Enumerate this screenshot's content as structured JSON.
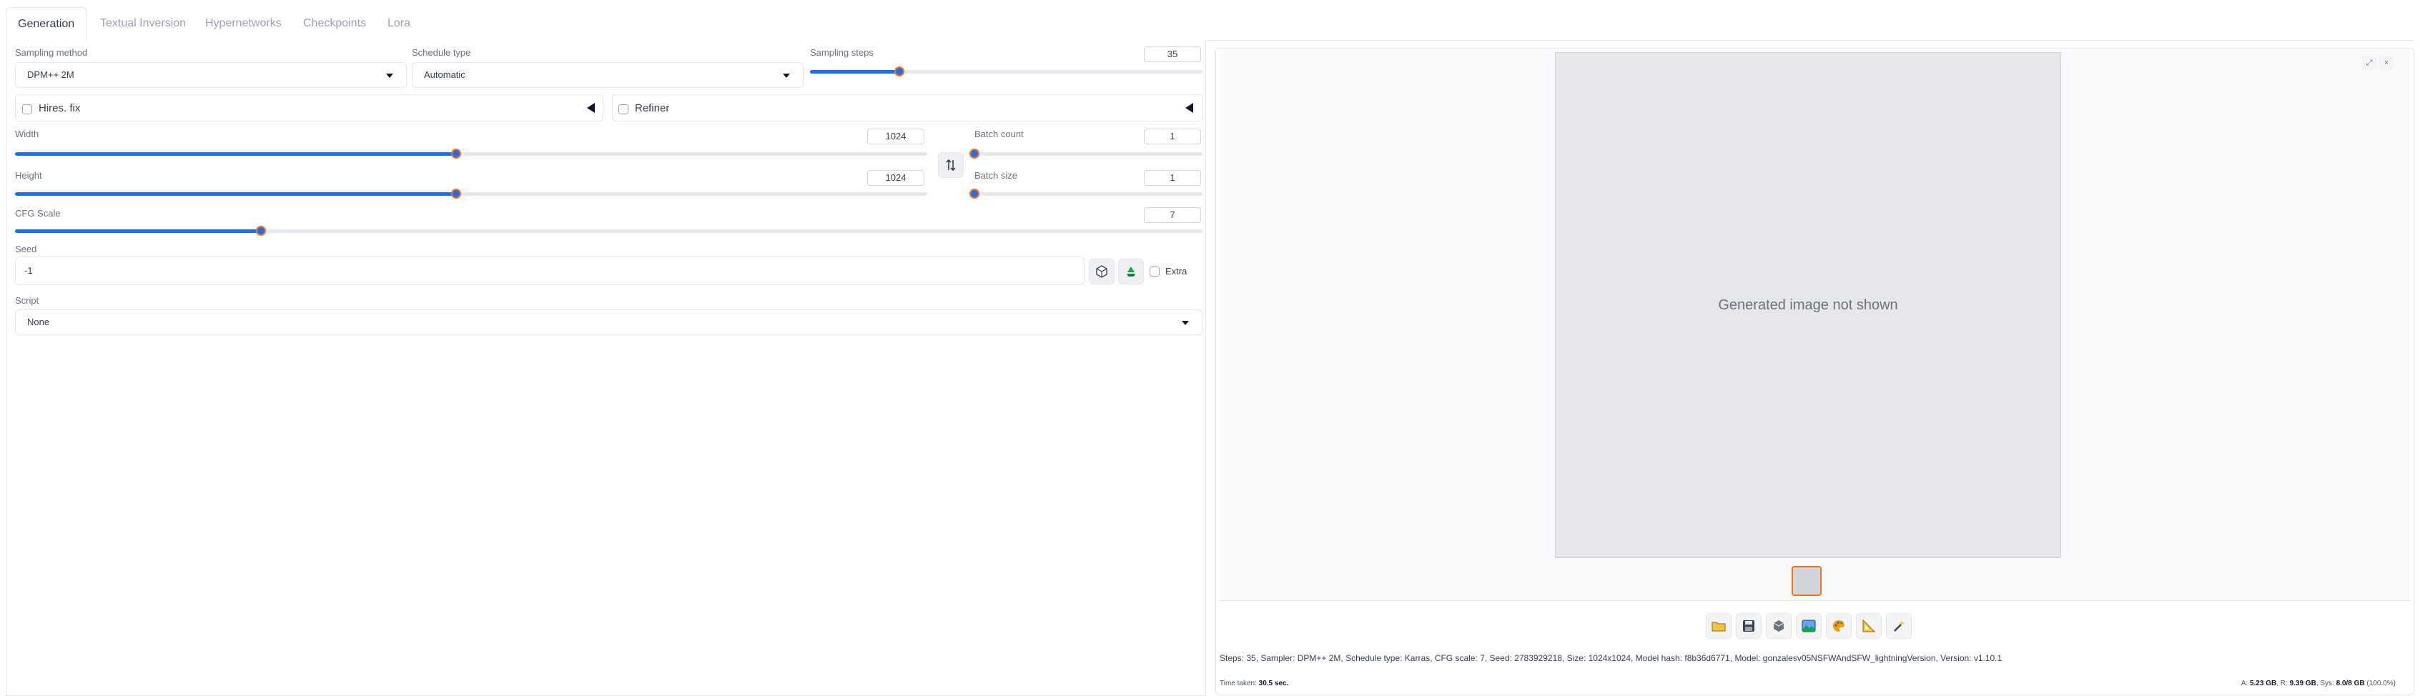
{
  "tabs": [
    "Generation",
    "Textual Inversion",
    "Hypernetworks",
    "Checkpoints",
    "Lora"
  ],
  "sampling_method": {
    "label": "Sampling method",
    "value": "DPM++ 2M"
  },
  "schedule_type": {
    "label": "Schedule type",
    "value": "Automatic"
  },
  "sampling_steps": {
    "label": "Sampling steps",
    "value": "35",
    "min": 1,
    "max": 150
  },
  "hires_fix": {
    "label": "Hires. fix",
    "checked": false
  },
  "refiner": {
    "label": "Refiner",
    "checked": false
  },
  "width": {
    "label": "Width",
    "value": "1024",
    "min": 64,
    "max": 2048
  },
  "height": {
    "label": "Height",
    "value": "1024",
    "min": 64,
    "max": 2048
  },
  "batch_count": {
    "label": "Batch count",
    "value": "1",
    "min": 1,
    "max": 100
  },
  "batch_size": {
    "label": "Batch size",
    "value": "1",
    "min": 1,
    "max": 8
  },
  "cfg_scale": {
    "label": "CFG Scale",
    "value": "7",
    "min": 1,
    "max": 30
  },
  "seed": {
    "label": "Seed",
    "value": "-1"
  },
  "extra": {
    "label": "Extra",
    "checked": false
  },
  "script": {
    "label": "Script",
    "value": "None"
  },
  "output": {
    "image_placeholder": "Generated image not shown",
    "close_btn": "×",
    "fullscreen_btn": "⤢",
    "generation_info": "Steps: 35, Sampler: DPM++ 2M, Schedule type: Karras, CFG scale: 7, Seed: 2783929218, Size: 1024x1024, Model hash: f8b36d6771, Model: gonzalesv05NSFWAndSFW_lightningVersion, Version: v1.10.1",
    "time_label": "Time taken:",
    "time_value": "30.5 sec.",
    "vram_a_label": "A:",
    "vram_a_value": "5.23 GB",
    "vram_r_label": "R:",
    "vram_r_value": "9.39 GB",
    "vram_sys_label": "Sys:",
    "vram_sys_value": "8.0/8 GB",
    "vram_pct": "(100.0%)"
  },
  "colors": {
    "accent": "#1d6ff2",
    "thumb_border": "#f97316"
  }
}
